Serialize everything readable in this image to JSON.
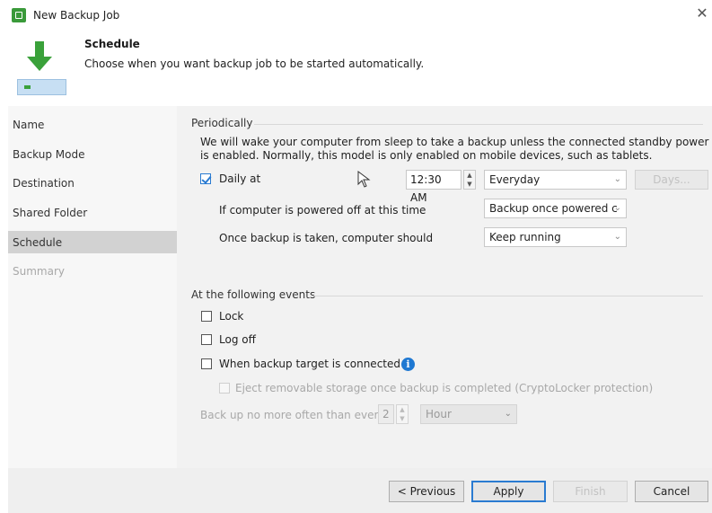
{
  "window": {
    "title": "New Backup Job",
    "close_glyph": "✕",
    "colors": {
      "app_icon": "#3a9a3a",
      "accent": "#2a7bd1",
      "selected_nav": "#d2d2d2",
      "arrow": "#3aa13a"
    }
  },
  "header": {
    "title": "Schedule",
    "description": "Choose when you want backup job to be started automatically.",
    "icon": "green-down-arrow-drive-icon"
  },
  "sidebar": {
    "items": [
      {
        "label": "Name",
        "state": "normal"
      },
      {
        "label": "Backup Mode",
        "state": "normal"
      },
      {
        "label": "Destination",
        "state": "normal"
      },
      {
        "label": "Shared Folder",
        "state": "normal"
      },
      {
        "label": "Schedule",
        "state": "selected"
      },
      {
        "label": "Summary",
        "state": "disabled"
      }
    ]
  },
  "periodically": {
    "label": "Periodically",
    "wake_notice_line1": "We will wake your computer from sleep to take a backup unless the connected standby power model",
    "wake_notice_line2": "is enabled. Normally, this model is only enabled on mobile devices, such as tablets.",
    "daily_at": {
      "label": "Daily at",
      "checked": true,
      "time": "12:30 AM",
      "frequency": "Everyday",
      "days_button": "Days..."
    },
    "powered_off": {
      "label": "If computer is powered off at this time",
      "value": "Backup once powered c"
    },
    "after_backup": {
      "label": "Once backup is taken, computer should",
      "value": "Keep running"
    }
  },
  "events": {
    "label": "At the following events",
    "lock": {
      "label": "Lock",
      "checked": false
    },
    "logoff": {
      "label": "Log off",
      "checked": false
    },
    "target_connected": {
      "label": "When backup target is connected",
      "checked": false,
      "info_glyph": "i"
    },
    "eject": {
      "label": "Eject removable storage once backup is completed (CryptoLocker protection)",
      "checked": false,
      "disabled": true
    },
    "no_more_often": {
      "label": "Back up no more often than every",
      "value": "2",
      "unit": "Hour",
      "disabled": true
    }
  },
  "footer": {
    "previous": "< Previous",
    "apply": "Apply",
    "finish": "Finish",
    "cancel": "Cancel"
  },
  "spin_glyphs": {
    "up": "▲",
    "down": "▼",
    "chevron": "⌄"
  }
}
